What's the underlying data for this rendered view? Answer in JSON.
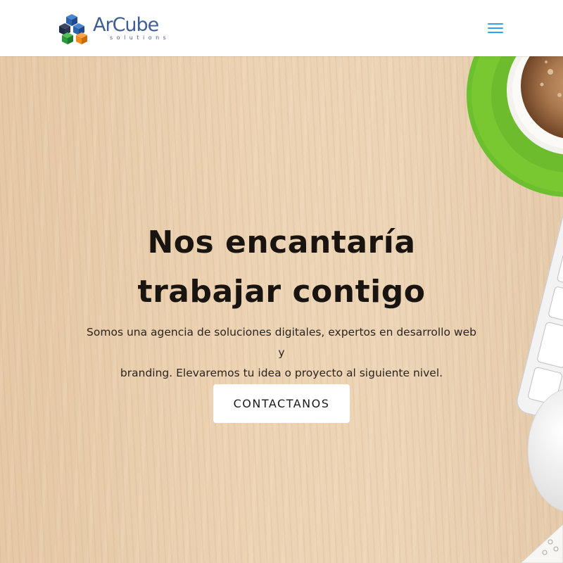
{
  "header": {
    "logo": {
      "name": "ArCube",
      "tagline": "solutions",
      "colors": [
        "#2b6cb8",
        "#2a9a3c",
        "#f08a1c",
        "#1f2a44"
      ]
    },
    "menu_icon": "hamburger-menu-icon",
    "accent_color": "#2ea3f2"
  },
  "hero": {
    "title_line1": "Nos encantaría",
    "title_line2": "trabajar contigo",
    "subtitle_line1": "Somos una agencia de soluciones digitales, expertos en desarrollo web y",
    "subtitle_line2": "branding. Elevaremos tu idea o proyecto al siguiente nivel.",
    "cta_label": "CONTACTANOS"
  }
}
